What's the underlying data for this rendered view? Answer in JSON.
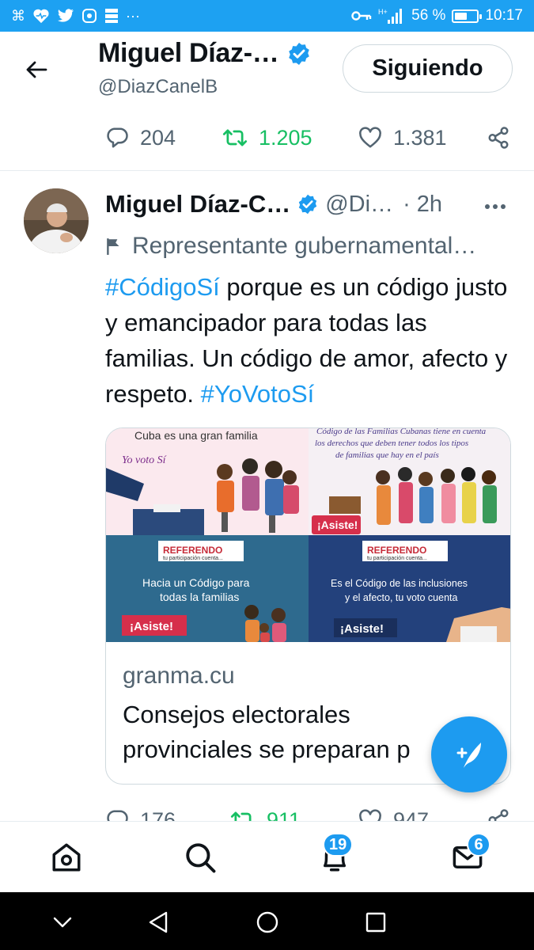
{
  "status_bar": {
    "left_icons": [
      "command-icon",
      "heart-monitor-icon",
      "twitter-icon",
      "vpn-icon",
      "storage-icon",
      "more-icon"
    ],
    "overflow": "···",
    "battery": "56 %",
    "battery_level": 0.56,
    "time": "10:17"
  },
  "header": {
    "name": "Miguel Díaz-…",
    "handle": "@DiazCanelB",
    "follow_button": "Siguiendo"
  },
  "prev_tweet_actions": {
    "replies": "204",
    "retweets": "1.205",
    "likes": "1.381"
  },
  "tweet": {
    "name": "Miguel Díaz-C…",
    "handle": "@Di…",
    "time": "· 2h",
    "more": "•••",
    "gov_label": "Representante gubernamental…",
    "text_parts": [
      {
        "text": "#CódigoSí",
        "tag": true
      },
      {
        "text": " porque es un código justo y emancipador para todas las familias. Un código de amor, afecto y respeto. ",
        "tag": false
      },
      {
        "text": "#YoVotoSí",
        "tag": true
      }
    ],
    "card": {
      "image_texts": {
        "panel1_title": "Cuba es una gran familia",
        "panel1_sub": "Yo voto Sí",
        "panel2_line1": "Código de las Familias Cubanas tiene en cuenta",
        "panel2_line2": "los derechos que deben tener todos los tipos",
        "panel2_line3": "de familias que hay en el país",
        "asiste": "¡Asiste!",
        "referendo": "REFERENDO",
        "participacion": "tu participación cuenta...",
        "panel3_line1": "Hacia un Código para",
        "panel3_line2": "todas la familias",
        "panel4_line1": "Es el Código de las inclusiones",
        "panel4_line2": "y el afecto, tu voto cuenta"
      },
      "domain": "granma.cu",
      "title": "Consejos electorales\nprovinciales se preparan p"
    }
  },
  "next_tweet_actions": {
    "replies": "176",
    "retweets": "911",
    "likes": "947"
  },
  "bottom_nav": {
    "notifications_badge": "19",
    "messages_badge": "6"
  },
  "colors": {
    "accent": "#1d9bf0",
    "status_bar": "#1da1f2",
    "retweet_green": "#17bf63",
    "secondary_text": "#536471"
  }
}
